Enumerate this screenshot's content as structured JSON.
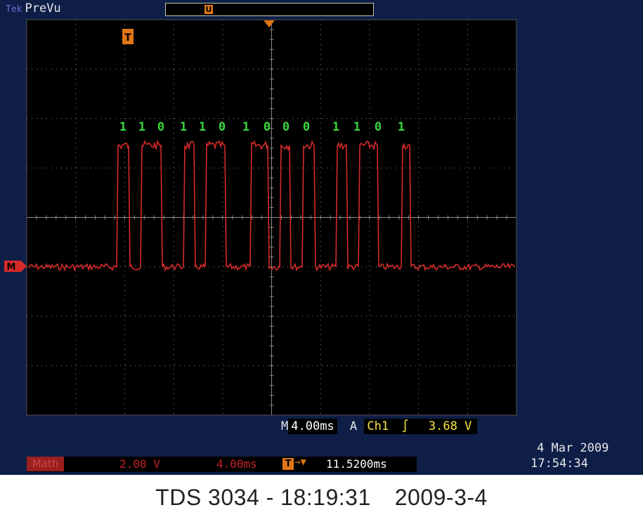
{
  "status": {
    "tek_label": "Tek",
    "mode": "PreVu"
  },
  "waveform_bits": [
    "1",
    "1",
    "0",
    "1",
    "1",
    "0",
    "1",
    "0",
    "0",
    "0",
    "1",
    "1",
    "0",
    "1"
  ],
  "channel_marker": "M",
  "trigger_marker": "T",
  "record_marker": "U",
  "timebase": {
    "prefix": "M",
    "scale": "4.00ms",
    "trigger_source_label": "A",
    "channel": "Ch1",
    "slope_icon": "rising-edge-icon",
    "level": "3.68 V"
  },
  "math": {
    "label": "Math",
    "volts": "2.00 V",
    "time": "4.00ms"
  },
  "trigger": {
    "icon_label": "T",
    "delay": "11.5200ms"
  },
  "datetime": {
    "date": "4 Mar 2009",
    "time": "17:54:34"
  },
  "caption": {
    "model": "TDS 3034",
    "sep": " - ",
    "time": "18:19:31",
    "date": "2009-3-4"
  },
  "colors": {
    "trace": "#d42a2a",
    "bits": "#39d93c",
    "grid": "#8a8a8a",
    "background": "#000000",
    "frame": "#0e1e47",
    "trigger": "#e07616"
  }
}
